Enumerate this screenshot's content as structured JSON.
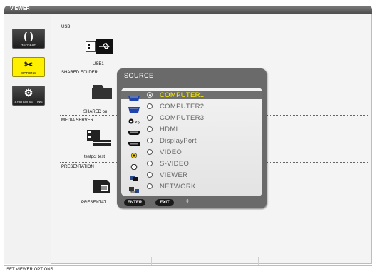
{
  "window": {
    "title": "VIEWER"
  },
  "sidebar": {
    "items": [
      {
        "label": "REFRESH",
        "icon": "refresh-icon",
        "glyph": "( )"
      },
      {
        "label": "OPTIONS",
        "icon": "options-icon",
        "glyph": "✂",
        "active": true
      },
      {
        "label": "SYSTEM SETTING",
        "icon": "system-setting-icon",
        "glyph": "⚙"
      }
    ]
  },
  "sections": {
    "usb": {
      "header": "USB",
      "item_label": "USB1"
    },
    "shared_folder": {
      "header": "SHARED FOLDER",
      "item_label": "SHARED on"
    },
    "media_server": {
      "header": "MEDIA SERVER",
      "item_label": "testpc: test"
    },
    "presentation": {
      "header": "PRESENTATION",
      "item_label": "PRESENTAT"
    }
  },
  "status": {
    "text": "SET VIEWER OPTIONS."
  },
  "dialog": {
    "title": "SOURCE",
    "sources": [
      {
        "label": "COMPUTER1",
        "icon": "vga-connector-icon",
        "selected": true
      },
      {
        "label": "COMPUTER2",
        "icon": "vga-connector-icon"
      },
      {
        "label": "COMPUTER3",
        "icon": "computer3-connector-icon",
        "icon_text": "×5"
      },
      {
        "label": "HDMI",
        "icon": "hdmi-connector-icon"
      },
      {
        "label": "DisplayPort",
        "icon": "displayport-connector-icon"
      },
      {
        "label": "VIDEO",
        "icon": "video-rca-icon"
      },
      {
        "label": "S-VIDEO",
        "icon": "s-video-icon"
      },
      {
        "label": "VIEWER",
        "icon": "viewer-icon"
      },
      {
        "label": "NETWORK",
        "icon": "network-icon"
      }
    ],
    "footer": {
      "enter": "ENTER",
      "exit": "EXIT",
      "nav": "⇕"
    }
  },
  "colors": {
    "selected_text": "#fff000",
    "active_sidebar": "#fff000",
    "dialog_frame": "#6a6a6a"
  }
}
